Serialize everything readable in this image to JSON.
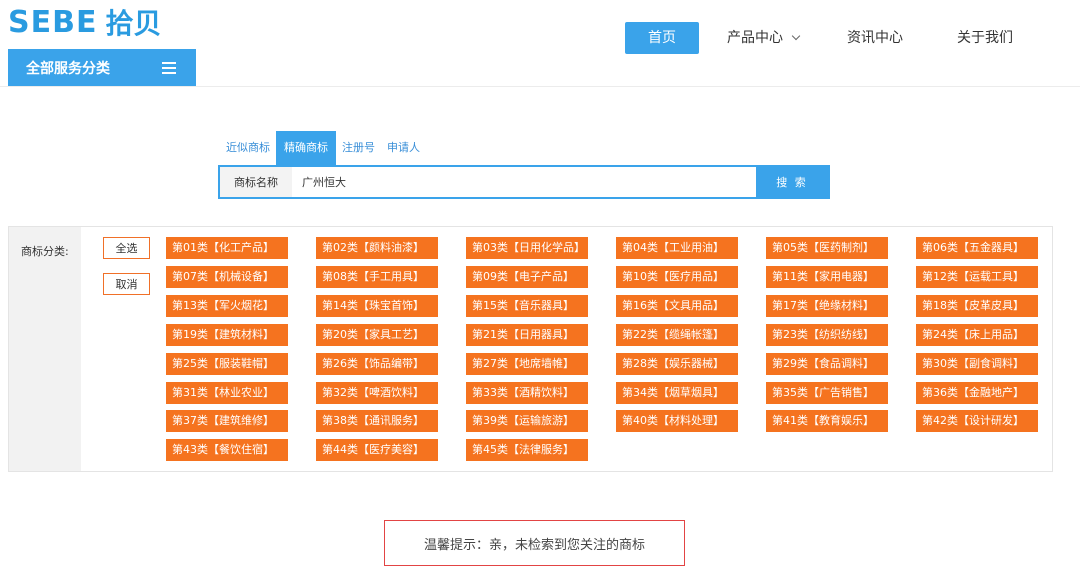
{
  "brand": {
    "latin": "SEBE",
    "chinese": "拾贝",
    "color": "#2a9be0"
  },
  "category_bar": {
    "label": "全部服务分类",
    "icon": "menu-icon"
  },
  "nav": [
    {
      "label": "首页",
      "active": true
    },
    {
      "label": "产品中心",
      "has_dropdown": true
    },
    {
      "label": "资讯中心"
    },
    {
      "label": "关于我们"
    }
  ],
  "search": {
    "tabs": [
      "近似商标",
      "精确商标",
      "注册号",
      "申请人"
    ],
    "active_tab": "精确商标",
    "field_label": "商标名称",
    "value": "广州恒大",
    "button_label": "搜 索"
  },
  "category_panel": {
    "label": "商标分类:",
    "select_all": "全选",
    "cancel": "取消",
    "items": [
      "第01类【化工产品】",
      "第02类【颜料油漆】",
      "第03类【日用化学品】",
      "第04类【工业用油】",
      "第05类【医药制剂】",
      "第06类【五金器具】",
      "第07类【机械设备】",
      "第08类【手工用具】",
      "第09类【电子产品】",
      "第10类【医疗用品】",
      "第11类【家用电器】",
      "第12类【运载工具】",
      "第13类【军火烟花】",
      "第14类【珠宝首饰】",
      "第15类【音乐器具】",
      "第16类【文具用品】",
      "第17类【绝缘材料】",
      "第18类【皮革皮具】",
      "第19类【建筑材料】",
      "第20类【家具工艺】",
      "第21类【日用器具】",
      "第22类【缆绳帐篷】",
      "第23类【纺织纺线】",
      "第24类【床上用品】",
      "第25类【服装鞋帽】",
      "第26类【饰品编带】",
      "第27类【地席墙帷】",
      "第28类【娱乐器械】",
      "第29类【食品调料】",
      "第30类【副食调料】",
      "第31类【林业农业】",
      "第32类【啤酒饮料】",
      "第33类【酒精饮料】",
      "第34类【烟草烟具】",
      "第35类【广告销售】",
      "第36类【金融地产】",
      "第37类【建筑维修】",
      "第38类【通讯服务】",
      "第39类【运输旅游】",
      "第40类【材料处理】",
      "第41类【教育娱乐】",
      "第42类【设计研发】",
      "第43类【餐饮住宿】",
      "第44类【医疗美容】",
      "第45类【法律服务】"
    ],
    "tag_color": "#f5731f"
  },
  "notice": {
    "text": "温馨提示：亲，未检索到您关注的商标",
    "border_color": "#e24444"
  },
  "accent_color": "#3aa3ea"
}
